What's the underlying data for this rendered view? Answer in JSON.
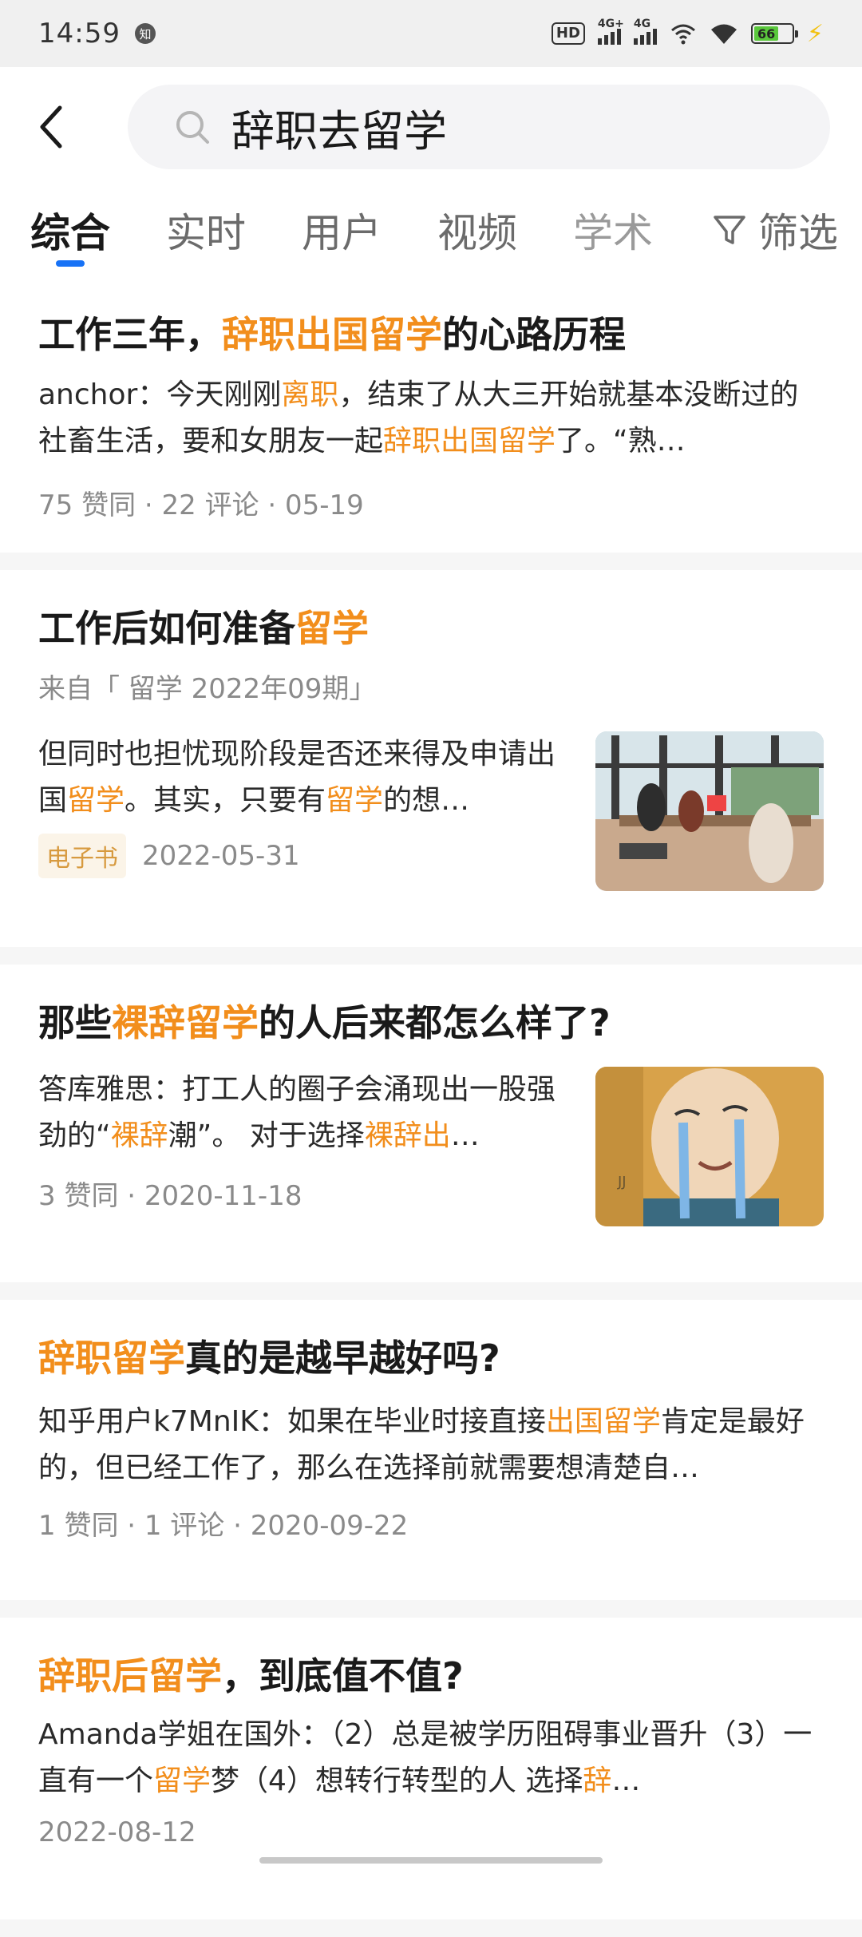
{
  "status": {
    "time": "14:59",
    "app_badge": "知",
    "hd": "HD",
    "sig1": "4G+",
    "sig2": "4G",
    "battery": "66",
    "battery_level": 0.66
  },
  "search": {
    "query": "辞职去留学"
  },
  "tabs": [
    {
      "label": "综合",
      "active": true
    },
    {
      "label": "实时"
    },
    {
      "label": "用户"
    },
    {
      "label": "视频"
    },
    {
      "label": "学术"
    }
  ],
  "filter_label": "筛选",
  "results": [
    {
      "title": [
        {
          "t": "工作三年，"
        },
        {
          "t": "辞职出国留学",
          "hl": true
        },
        {
          "t": "的心路历程"
        }
      ],
      "excerpt": [
        {
          "t": "anchor：今天刚刚"
        },
        {
          "t": "离职",
          "hl": true
        },
        {
          "t": "，结束了从大三开始就基本没断过的社畜生活，要和女朋友一起"
        },
        {
          "t": "辞职出国留学",
          "hl": true
        },
        {
          "t": "了。“熟…"
        }
      ],
      "meta": "75 赞同 · 22 评论 · 05-19"
    },
    {
      "title": [
        {
          "t": "工作后如何准备"
        },
        {
          "t": "留学",
          "hl": true
        }
      ],
      "source": "来自「 留学 2022年09期」",
      "excerpt": [
        {
          "t": "但同时也担忧现阶段是否还来得及申请出国"
        },
        {
          "t": "留学",
          "hl": true
        },
        {
          "t": "。其实，只要有"
        },
        {
          "t": "留学",
          "hl": true
        },
        {
          "t": "的想…"
        }
      ],
      "tag": "电子书",
      "meta": "2022-05-31",
      "thumb": "office"
    },
    {
      "title": [
        {
          "t": "那些"
        },
        {
          "t": "裸辞留学",
          "hl": true
        },
        {
          "t": "的人后来都怎么样了?"
        }
      ],
      "excerpt": [
        {
          "t": "答库雅思：打工人的圈子会涌现出一股强劲的“"
        },
        {
          "t": "裸辞",
          "hl": true
        },
        {
          "t": "潮”。 对于选择"
        },
        {
          "t": "裸辞出",
          "hl": true
        },
        {
          "t": "…"
        }
      ],
      "meta": "3 赞同 · 2020-11-18",
      "thumb": "cartoon"
    },
    {
      "title": [
        {
          "t": "辞职留学",
          "hl": true
        },
        {
          "t": "真的是越早越好吗?"
        }
      ],
      "excerpt": [
        {
          "t": "知乎用户k7MnIK：如果在毕业时接直接"
        },
        {
          "t": "出国留学",
          "hl": true
        },
        {
          "t": "肯定是最好的，但已经工作了，那么在选择前就需要想清楚自…"
        }
      ],
      "meta": "1 赞同 · 1 评论 · 2020-09-22"
    },
    {
      "title": [
        {
          "t": "辞职后留学",
          "hl": true
        },
        {
          "t": "，到底值不值?"
        }
      ],
      "excerpt": [
        {
          "t": "Amanda学姐在国外：（2）总是被学历阻碍事业晋升（3）一直有一个"
        },
        {
          "t": "留学",
          "hl": true
        },
        {
          "t": "梦（4）想转行转型的人 选择"
        },
        {
          "t": "辞",
          "hl": true
        },
        {
          "t": "…"
        }
      ],
      "meta": "2022-08-12"
    }
  ],
  "colors": {
    "highlight": "#f28e1c",
    "active_tab_indicator": "#1772f6",
    "tag_text": "#d79a3f"
  }
}
